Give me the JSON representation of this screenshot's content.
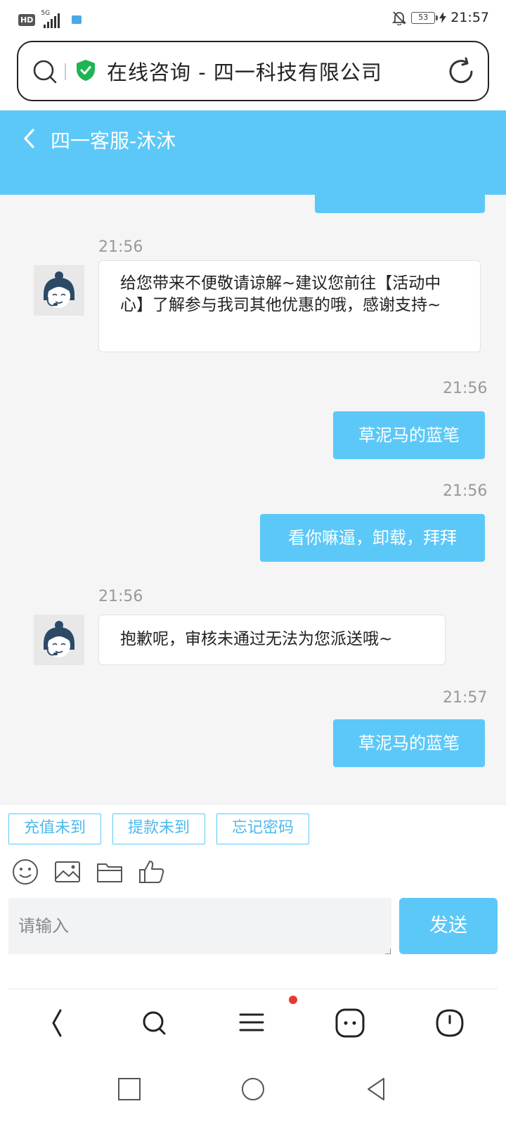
{
  "status_bar": {
    "hd": "HD",
    "network": "5G",
    "battery": "53",
    "time": "21:57"
  },
  "url_bar": {
    "title": "在线咨询 - 四一科技有限公司"
  },
  "chat": {
    "title": "四一客服-沐沐",
    "messages": [
      {
        "time": "21:56",
        "from": "agent",
        "text": "给您带来不便敬请谅解~建议您前往【活动中心】了解参与我司其他优惠的哦，感谢支持~"
      },
      {
        "time": "21:56",
        "from": "user",
        "text": "草泥马的蓝笔"
      },
      {
        "time": "21:56",
        "from": "user",
        "text": "看你嘛逼，卸载，拜拜"
      },
      {
        "time": "21:56",
        "from": "agent",
        "text": "抱歉呢，审核未通过无法为您派送哦~"
      },
      {
        "time": "21:57",
        "from": "user",
        "text": "草泥马的蓝笔"
      }
    ]
  },
  "quick_replies": [
    "充值未到",
    "提款未到",
    "忘记密码"
  ],
  "input": {
    "placeholder": "请输入",
    "send_label": "发送"
  },
  "colors": {
    "accent": "#5cc8f8",
    "chat_bg": "#f5f5f5",
    "notification": "#e53935"
  },
  "icons": {
    "tools": [
      "emoji-icon",
      "image-icon",
      "folder-icon",
      "thumbs-up-icon"
    ],
    "browser_nav": [
      "back-icon",
      "search-icon",
      "menu-icon",
      "tabs-icon",
      "home-icon"
    ],
    "system_nav": [
      "recents-icon",
      "home-circle-icon",
      "back-triangle-icon"
    ]
  }
}
